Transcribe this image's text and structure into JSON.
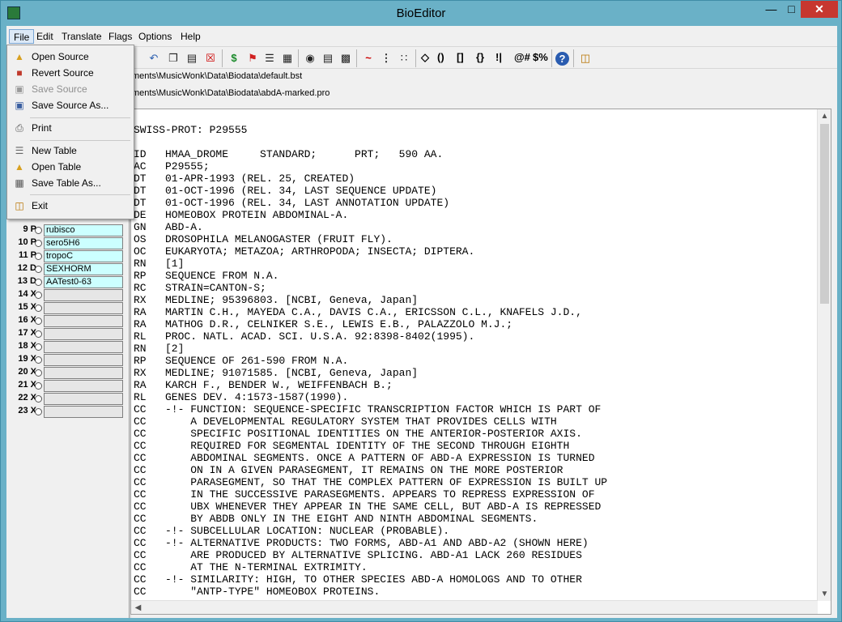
{
  "window": {
    "title": "BioEditor"
  },
  "menubar": [
    "File",
    "Edit",
    "Translate",
    "Flags",
    "Options",
    "Help"
  ],
  "file_menu": {
    "items": [
      {
        "label": "Open Source",
        "icon": "folder-open-icon",
        "enabled": true
      },
      {
        "label": "Revert Source",
        "icon": "revert-icon",
        "enabled": true
      },
      {
        "label": "Save Source",
        "icon": "save-icon",
        "enabled": false
      },
      {
        "label": "Save Source As...",
        "icon": "save-as-icon",
        "enabled": true
      },
      {
        "label": "Print",
        "icon": "printer-icon",
        "enabled": true
      },
      {
        "label": "New Table",
        "icon": "new-table-icon",
        "enabled": true
      },
      {
        "label": "Open Table",
        "icon": "open-table-icon",
        "enabled": true
      },
      {
        "label": "Save Table As...",
        "icon": "save-table-icon",
        "enabled": true
      },
      {
        "label": "Exit",
        "icon": "exit-icon",
        "enabled": true
      }
    ]
  },
  "toolbar": {
    "text_buttons": [
      "◇",
      "()",
      "[]",
      "{}",
      "!|",
      "@#",
      "$%"
    ]
  },
  "paths": {
    "table": "ments\\MusicWonk\\Data\\Biodata\\default.bst",
    "source": "ments\\MusicWonk\\Data\\Biodata\\abdA-marked.pro"
  },
  "table_rows": [
    {
      "num": "9 P",
      "name": "rubisco"
    },
    {
      "num": "10 P",
      "name": "sero5H6"
    },
    {
      "num": "11 P",
      "name": "tropoC"
    },
    {
      "num": "12 D",
      "name": "SEXHORM"
    },
    {
      "num": "13 D",
      "name": "AATest0-63"
    },
    {
      "num": "14 X",
      "name": ""
    },
    {
      "num": "15 X",
      "name": ""
    },
    {
      "num": "16 X",
      "name": ""
    },
    {
      "num": "17 X",
      "name": ""
    },
    {
      "num": "18 X",
      "name": ""
    },
    {
      "num": "19 X",
      "name": ""
    },
    {
      "num": "20 X",
      "name": ""
    },
    {
      "num": "21 X",
      "name": ""
    },
    {
      "num": "22 X",
      "name": ""
    },
    {
      "num": "23 X",
      "name": ""
    }
  ],
  "editor": {
    "lines": [
      "SWISS-PROT: P29555",
      "",
      "ID   HMAA_DROME     STANDARD;      PRT;   590 AA.",
      "AC   P29555;",
      "DT   01-APR-1993 (REL. 25, CREATED)",
      "DT   01-OCT-1996 (REL. 34, LAST SEQUENCE UPDATE)",
      "DT   01-OCT-1996 (REL. 34, LAST ANNOTATION UPDATE)",
      "DE   HOMEOBOX PROTEIN ABDOMINAL-A.",
      "GN   ABD-A.",
      "OS   DROSOPHILA MELANOGASTER (FRUIT FLY).",
      "OC   EUKARYOTA; METAZOA; ARTHROPODA; INSECTA; DIPTERA.",
      "RN   [1]",
      "RP   SEQUENCE FROM N.A.",
      "RC   STRAIN=CANTON-S;",
      "RX   MEDLINE; 95396803. [NCBI, Geneva, Japan]",
      "RA   MARTIN C.H., MAYEDA C.A., DAVIS C.A., ERICSSON C.L., KNAFELS J.D.,",
      "RA   MATHOG D.R., CELNIKER S.E., LEWIS E.B., PALAZZOLO M.J.;",
      "RL   PROC. NATL. ACAD. SCI. U.S.A. 92:8398-8402(1995).",
      "RN   [2]",
      "RP   SEQUENCE OF 261-590 FROM N.A.",
      "RX   MEDLINE; 91071585. [NCBI, Geneva, Japan]",
      "RA   KARCH F., BENDER W., WEIFFENBACH B.;",
      "RL   GENES DEV. 4:1573-1587(1990).",
      "CC   -!- FUNCTION: SEQUENCE-SPECIFIC TRANSCRIPTION FACTOR WHICH IS PART OF",
      "CC       A DEVELOPMENTAL REGULATORY SYSTEM THAT PROVIDES CELLS WITH",
      "CC       SPECIFIC POSITIONAL IDENTITIES ON THE ANTERIOR-POSTERIOR AXIS.",
      "CC       REQUIRED FOR SEGMENTAL IDENTITY OF THE SECOND THROUGH EIGHTH",
      "CC       ABDOMINAL SEGMENTS. ONCE A PATTERN OF ABD-A EXPRESSION IS TURNED",
      "CC       ON IN A GIVEN PARASEGMENT, IT REMAINS ON THE MORE POSTERIOR",
      "CC       PARASEGMENT, SO THAT THE COMPLEX PATTERN OF EXPRESSION IS BUILT UP",
      "CC       IN THE SUCCESSIVE PARASEGMENTS. APPEARS TO REPRESS EXPRESSION OF",
      "CC       UBX WHENEVER THEY APPEAR IN THE SAME CELL, BUT ABD-A IS REPRESSED",
      "CC       BY ABDB ONLY IN THE EIGHT AND NINTH ABDOMINAL SEGMENTS.",
      "CC   -!- SUBCELLULAR LOCATION: NUCLEAR (PROBABLE).",
      "CC   -!- ALTERNATIVE PRODUCTS: TWO FORMS, ABD-A1 AND ABD-A2 (SHOWN HERE)",
      "CC       ARE PRODUCED BY ALTERNATIVE SPLICING. ABD-A1 LACK 260 RESIDUES",
      "CC       AT THE N-TERMINAL EXTRIMITY.",
      "CC   -!- SIMILARITY: HIGH, TO OTHER SPECIES ABD-A HOMOLOGS AND TO OTHER",
      "CC       \"ANTP-TYPE\" HOMEOBOX PROTEINS."
    ]
  }
}
